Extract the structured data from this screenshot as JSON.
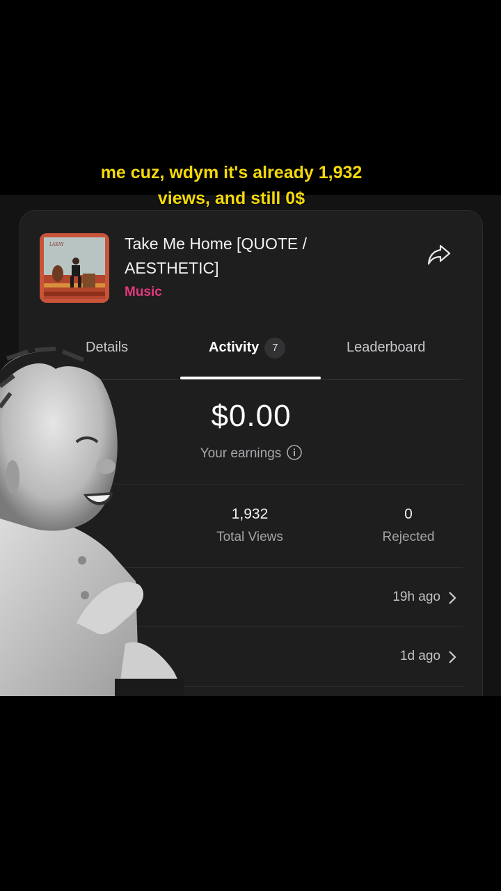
{
  "caption": {
    "line1": "me cuz, wdym it's already 1,932",
    "line2": "views, and still 0$"
  },
  "campaign": {
    "title_line1": "Take Me Home [QUOTE /",
    "title_line2": "AESTHETIC]",
    "category": "Music",
    "category_color": "#e23a7a",
    "share_icon": "share-icon",
    "cover_text": "LAKAY"
  },
  "tabs": [
    {
      "label": "Details",
      "active": false
    },
    {
      "label": "Activity",
      "active": true,
      "badge": "7"
    },
    {
      "label": "Leaderboard",
      "active": false
    }
  ],
  "earnings": {
    "amount": "$0.00",
    "label": "Your earnings",
    "info_icon": "info-icon"
  },
  "stats": [
    {
      "value": "1,932",
      "label": "Total Views"
    },
    {
      "value": "0",
      "label": "Rejected"
    }
  ],
  "activity": [
    {
      "time": "19h ago"
    },
    {
      "time": "1d ago"
    }
  ]
}
